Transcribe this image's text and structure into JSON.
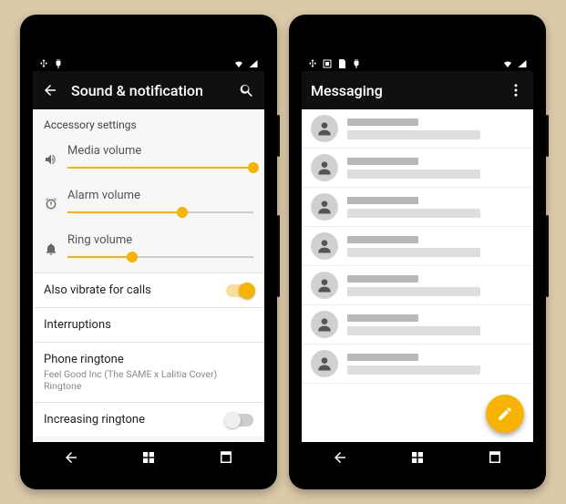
{
  "phone_left": {
    "appbar": {
      "title": "Sound & notification"
    },
    "section_header": "Accessory settings",
    "sliders": {
      "media": {
        "label": "Media volume",
        "percent": 100
      },
      "alarm": {
        "label": "Alarm volume",
        "percent": 62
      },
      "ring": {
        "label": "Ring volume",
        "percent": 35
      }
    },
    "items": {
      "vibrate": {
        "label": "Also vibrate for calls",
        "on": true
      },
      "interrupt": {
        "label": "Interruptions"
      },
      "ringtone": {
        "label": "Phone ringtone",
        "sub": "Feel Good Inc (The SAME x Lalitia Cover) Ringtone"
      },
      "increasing": {
        "label": "Increasing ringtone",
        "on": false
      }
    }
  },
  "phone_right": {
    "appbar": {
      "title": "Messaging"
    },
    "rows": 7
  },
  "colors": {
    "accent": "#f6b400"
  }
}
